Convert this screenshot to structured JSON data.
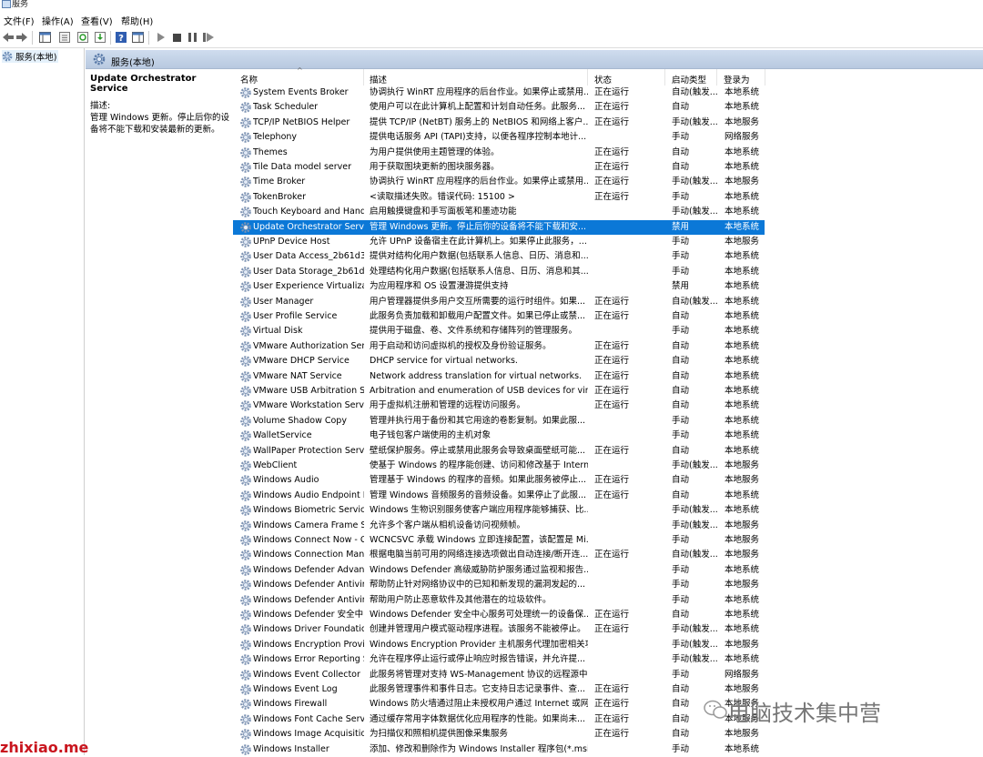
{
  "window": {
    "title": "服务"
  },
  "menu": [
    {
      "label": "文件(F)"
    },
    {
      "label": "操作(A)"
    },
    {
      "label": "查看(V)"
    },
    {
      "label": "帮助(H)"
    }
  ],
  "tree": {
    "root_label": "服务(本地)"
  },
  "panel": {
    "header": "服务(本地)"
  },
  "extended": {
    "title": "Update Orchestrator Service",
    "desc_label": "描述:",
    "desc_text": "管理 Windows 更新。停止后你的设备将不能下载和安装最新的更新。"
  },
  "columns": {
    "name": "名称",
    "desc": "描述",
    "status": "状态",
    "start": "启动类型",
    "logon": "登录为"
  },
  "selected_index": 9,
  "rows": [
    {
      "name": "System Events Broker",
      "desc": "协调执行 WinRT 应用程序的后台作业。如果停止或禁用...",
      "status": "正在运行",
      "start": "自动(触发...",
      "logon": "本地系统"
    },
    {
      "name": "Task Scheduler",
      "desc": "使用户可以在此计算机上配置和计划自动任务。此服务...",
      "status": "正在运行",
      "start": "自动",
      "logon": "本地系统"
    },
    {
      "name": "TCP/IP NetBIOS Helper",
      "desc": "提供 TCP/IP (NetBT) 服务上的 NetBIOS 和网络上客户...",
      "status": "正在运行",
      "start": "手动(触发...",
      "logon": "本地服务"
    },
    {
      "name": "Telephony",
      "desc": "提供电话服务 API (TAPI)支持，以便各程序控制本地计...",
      "status": "",
      "start": "手动",
      "logon": "网络服务"
    },
    {
      "name": "Themes",
      "desc": "为用户提供使用主题管理的体验。",
      "status": "正在运行",
      "start": "自动",
      "logon": "本地系统"
    },
    {
      "name": "Tile Data model server",
      "desc": "用于获取图块更新的图块服务器。",
      "status": "正在运行",
      "start": "自动",
      "logon": "本地系统"
    },
    {
      "name": "Time Broker",
      "desc": "协调执行 WinRT 应用程序的后台作业。如果停止或禁用...",
      "status": "正在运行",
      "start": "手动(触发...",
      "logon": "本地服务"
    },
    {
      "name": "TokenBroker",
      "desc": "<读取描述失败。错误代码: 15100 >",
      "status": "正在运行",
      "start": "手动",
      "logon": "本地系统"
    },
    {
      "name": "Touch Keyboard and Hand...",
      "desc": "启用触摸键盘和手写面板笔和墨迹功能",
      "status": "",
      "start": "手动(触发...",
      "logon": "本地系统"
    },
    {
      "name": "Update Orchestrator Service",
      "desc": "管理 Windows 更新。停止后你的设备将不能下载和安...",
      "status": "",
      "start": "禁用",
      "logon": "本地系统"
    },
    {
      "name": "UPnP Device Host",
      "desc": "允许 UPnP 设备宿主在此计算机上。如果停止此服务，...",
      "status": "",
      "start": "手动",
      "logon": "本地服务"
    },
    {
      "name": "User Data Access_2b61d305",
      "desc": "提供对结构化用户数据(包括联系人信息、日历、消息和...",
      "status": "",
      "start": "手动",
      "logon": "本地系统"
    },
    {
      "name": "User Data Storage_2b61d3...",
      "desc": "处理结构化用户数据(包括联系人信息、日历、消息和其...",
      "status": "",
      "start": "手动",
      "logon": "本地系统"
    },
    {
      "name": "User Experience Virtualizat...",
      "desc": "为应用程序和 OS 设置漫游提供支持",
      "status": "",
      "start": "禁用",
      "logon": "本地系统"
    },
    {
      "name": "User Manager",
      "desc": "用户管理器提供多用户交互所需要的运行时组件。如果...",
      "status": "正在运行",
      "start": "自动(触发...",
      "logon": "本地系统"
    },
    {
      "name": "User Profile Service",
      "desc": "此服务负责加载和卸载用户配置文件。如果已停止或禁...",
      "status": "正在运行",
      "start": "自动",
      "logon": "本地系统"
    },
    {
      "name": "Virtual Disk",
      "desc": "提供用于磁盘、卷、文件系统和存储阵列的管理服务。",
      "status": "",
      "start": "手动",
      "logon": "本地系统"
    },
    {
      "name": "VMware Authorization Ser...",
      "desc": "用于启动和访问虚拟机的授权及身份验证服务。",
      "status": "正在运行",
      "start": "自动",
      "logon": "本地系统"
    },
    {
      "name": "VMware DHCP Service",
      "desc": "DHCP service for virtual networks.",
      "status": "正在运行",
      "start": "自动",
      "logon": "本地系统"
    },
    {
      "name": "VMware NAT Service",
      "desc": "Network address translation for virtual networks.",
      "status": "正在运行",
      "start": "自动",
      "logon": "本地系统"
    },
    {
      "name": "VMware USB Arbitration S...",
      "desc": "Arbitration and enumeration of USB devices for virtual ...",
      "status": "正在运行",
      "start": "自动",
      "logon": "本地系统"
    },
    {
      "name": "VMware Workstation Server",
      "desc": "用于虚拟机注册和管理的远程访问服务。",
      "status": "正在运行",
      "start": "自动",
      "logon": "本地系统"
    },
    {
      "name": "Volume Shadow Copy",
      "desc": "管理并执行用于备份和其它用途的卷影复制。如果此服...",
      "status": "",
      "start": "手动",
      "logon": "本地系统"
    },
    {
      "name": "WalletService",
      "desc": "电子钱包客户端使用的主机对象",
      "status": "",
      "start": "手动",
      "logon": "本地系统"
    },
    {
      "name": "WallPaper Protection Servi...",
      "desc": "壁纸保护服务。停止或禁用此服务会导致桌面壁纸可能...",
      "status": "正在运行",
      "start": "自动",
      "logon": "本地系统"
    },
    {
      "name": "WebClient",
      "desc": "使基于 Windows 的程序能创建、访问和修改基于 Intern...",
      "status": "",
      "start": "手动(触发...",
      "logon": "本地服务"
    },
    {
      "name": "Windows Audio",
      "desc": "管理基于 Windows 的程序的音频。如果此服务被停止...",
      "status": "正在运行",
      "start": "自动",
      "logon": "本地服务"
    },
    {
      "name": "Windows Audio Endpoint B...",
      "desc": "管理 Windows 音频服务的音频设备。如果停止了此服...",
      "status": "正在运行",
      "start": "自动",
      "logon": "本地系统"
    },
    {
      "name": "Windows Biometric Service",
      "desc": "Windows 生物识别服务使客户端应用程序能够捕获、比...",
      "status": "",
      "start": "手动(触发...",
      "logon": "本地系统"
    },
    {
      "name": "Windows Camera Frame S...",
      "desc": "允许多个客户端从相机设备访问视频帧。",
      "status": "",
      "start": "手动(触发...",
      "logon": "本地服务"
    },
    {
      "name": "Windows Connect Now - C...",
      "desc": "WCNCSVC 承载 Windows 立即连接配置，该配置是 Mi...",
      "status": "",
      "start": "手动",
      "logon": "本地服务"
    },
    {
      "name": "Windows Connection Man...",
      "desc": "根据电脑当前可用的网络连接选项做出自动连接/断开连...",
      "status": "正在运行",
      "start": "自动(触发...",
      "logon": "本地服务"
    },
    {
      "name": "Windows Defender Advan...",
      "desc": "Windows Defender 高级威胁防护服务通过监视和报告...",
      "status": "",
      "start": "手动",
      "logon": "本地系统"
    },
    {
      "name": "Windows Defender Antivir...",
      "desc": "帮助防止针对网络协议中的已知和新发现的漏洞发起的...",
      "status": "",
      "start": "手动",
      "logon": "本地服务"
    },
    {
      "name": "Windows Defender Antivir...",
      "desc": "帮助用户防止恶意软件及其他潜在的垃圾软件。",
      "status": "",
      "start": "手动",
      "logon": "本地系统"
    },
    {
      "name": "Windows Defender 安全中...",
      "desc": "Windows Defender 安全中心服务可处理统一的设备保...",
      "status": "正在运行",
      "start": "自动",
      "logon": "本地系统"
    },
    {
      "name": "Windows Driver Foundatio...",
      "desc": "创建并管理用户模式驱动程序进程。该服务不能被停止。",
      "status": "正在运行",
      "start": "手动(触发...",
      "logon": "本地系统"
    },
    {
      "name": "Windows Encryption Provid...",
      "desc": "Windows Encryption Provider 主机服务代理加密相关功...",
      "status": "",
      "start": "手动(触发...",
      "logon": "本地服务"
    },
    {
      "name": "Windows Error Reporting S...",
      "desc": "允许在程序停止运行或停止响应时报告错误，并允许提...",
      "status": "",
      "start": "手动(触发...",
      "logon": "本地系统"
    },
    {
      "name": "Windows Event Collector",
      "desc": "此服务将管理对支持 WS-Management 协议的远程源中...",
      "status": "",
      "start": "手动",
      "logon": "网络服务"
    },
    {
      "name": "Windows Event Log",
      "desc": "此服务管理事件和事件日志。它支持日志记录事件、查...",
      "status": "正在运行",
      "start": "自动",
      "logon": "本地服务"
    },
    {
      "name": "Windows Firewall",
      "desc": "Windows 防火墙通过阻止未授权用户通过 Internet 或网...",
      "status": "正在运行",
      "start": "自动",
      "logon": "本地服务"
    },
    {
      "name": "Windows Font Cache Servi...",
      "desc": "通过缓存常用字体数据优化应用程序的性能。如果尚未...",
      "status": "正在运行",
      "start": "自动",
      "logon": "本地服务"
    },
    {
      "name": "Windows Image Acquisitio...",
      "desc": "为扫描仪和照相机提供图像采集服务",
      "status": "正在运行",
      "start": "自动",
      "logon": "本地服务"
    },
    {
      "name": "Windows Installer",
      "desc": "添加、修改和删除作为 Windows Installer 程序包(*.msi...",
      "status": "",
      "start": "手动",
      "logon": "本地系统"
    }
  ],
  "watermarks": {
    "left": "zhixiao.me",
    "right": "电脑技术集中营"
  }
}
